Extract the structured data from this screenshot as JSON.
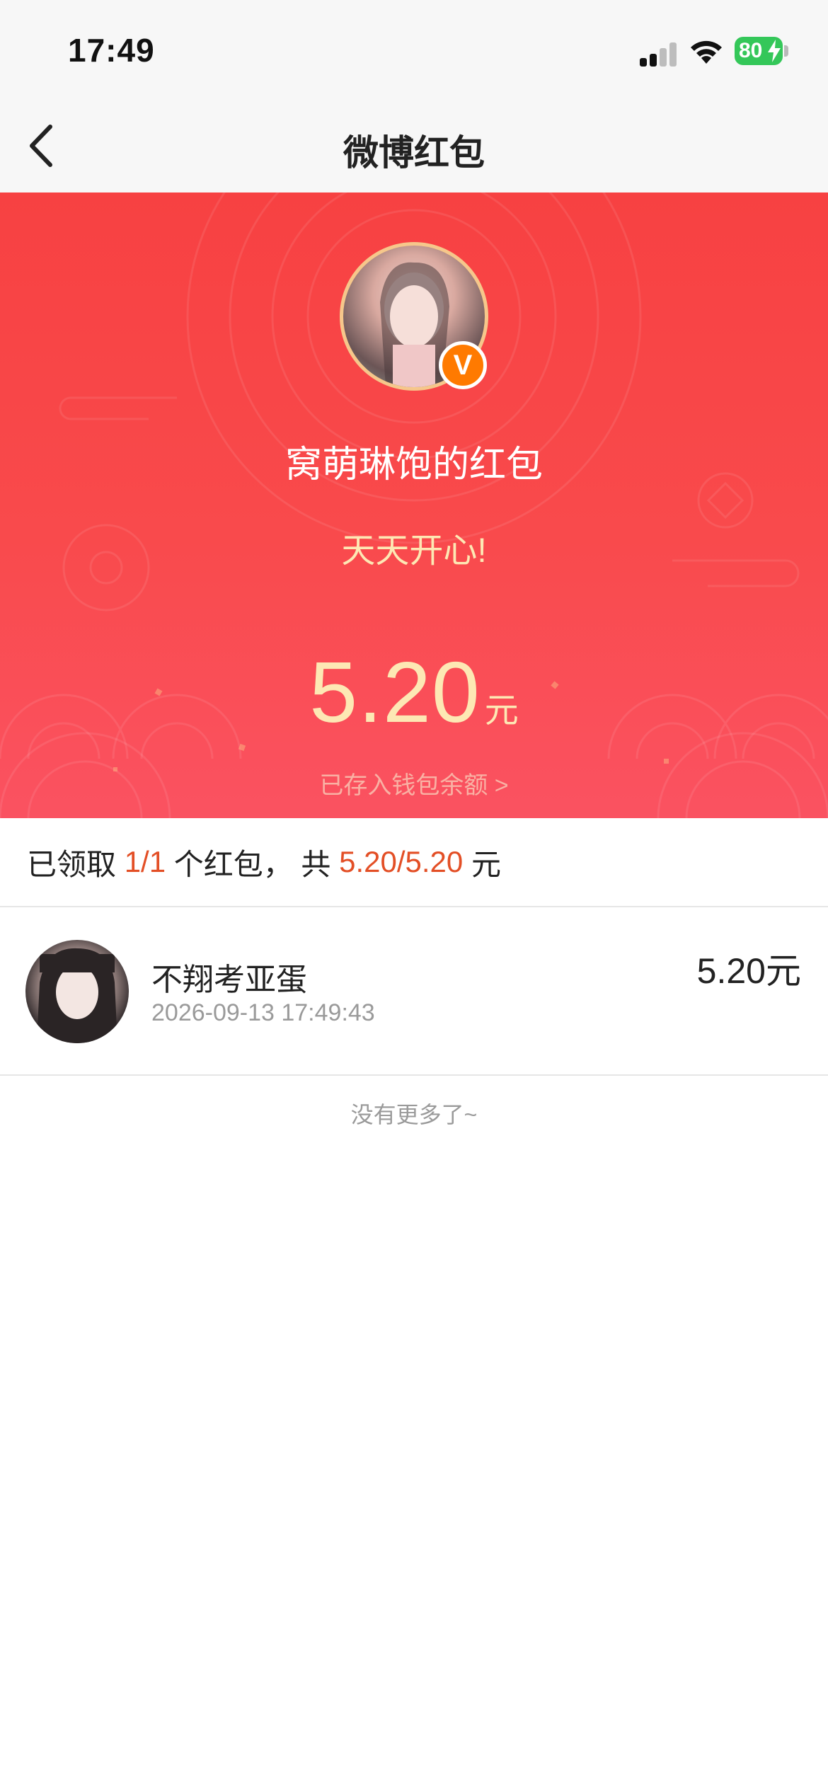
{
  "status_bar": {
    "time": "17:49",
    "battery": "80",
    "signal_icon": "cellular-signal-icon",
    "wifi_icon": "wifi-icon"
  },
  "nav": {
    "title": "微博红包",
    "back_icon": "chevron-left-icon"
  },
  "hero": {
    "sender_name": "窝萌琳饱的红包",
    "verified_badge": "V",
    "greeting": "天天开心!",
    "amount": "5.20",
    "amount_unit": "元",
    "wallet_link": "已存入钱包余额 >",
    "background_color": "#f74142",
    "accent_color": "#fde8b4"
  },
  "summary": {
    "prefix": "已领取",
    "count": "1/1",
    "middle": "个红包， 共",
    "total": "5.20/5.20",
    "suffix": "元",
    "highlight_color": "#e34f26"
  },
  "receivers": [
    {
      "name": "不翔考亚蛋",
      "time": "2026-09-13 17:49:43",
      "amount": "5.20元"
    }
  ],
  "footer": {
    "no_more": "没有更多了~"
  }
}
